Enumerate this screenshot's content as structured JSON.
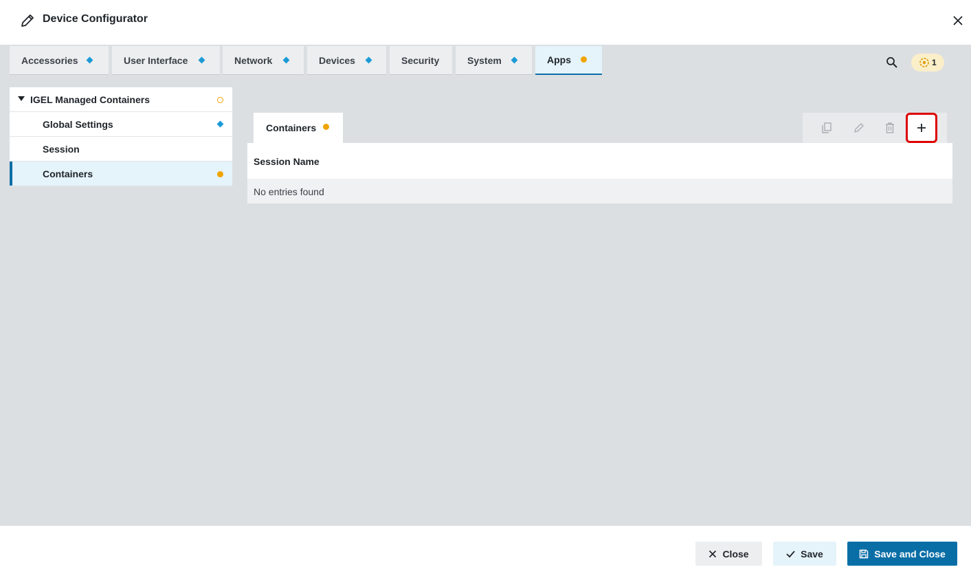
{
  "header": {
    "title": "Device Configurator",
    "edit_icon": "pencil-icon",
    "close_icon": "close-icon"
  },
  "tabs": [
    {
      "label": "Accessories",
      "marker": "diamond"
    },
    {
      "label": "User Interface",
      "marker": "diamond"
    },
    {
      "label": "Network",
      "marker": "diamond"
    },
    {
      "label": "Devices",
      "marker": "diamond"
    },
    {
      "label": "Security",
      "marker": "none"
    },
    {
      "label": "System",
      "marker": "diamond"
    },
    {
      "label": "Apps",
      "marker": "dot",
      "active": true
    }
  ],
  "top_right": {
    "search_icon": "search-icon",
    "notification_icon": "gear-eye-icon",
    "notification_count": "1"
  },
  "tree": {
    "root": {
      "label": "IGEL Managed Containers",
      "marker": "ring",
      "expanded": true
    },
    "items": [
      {
        "label": "Global Settings",
        "marker": "diamond"
      },
      {
        "label": "Session",
        "marker": "none"
      },
      {
        "label": "Containers",
        "marker": "dot",
        "selected": true
      }
    ]
  },
  "panel": {
    "tab_label": "Containers",
    "tab_marker": "dot",
    "toolbar": [
      "copy-icon",
      "edit-icon",
      "delete-icon",
      "add-icon"
    ],
    "table": {
      "columns": [
        "Session Name"
      ],
      "empty_text": "No entries found"
    }
  },
  "footer": {
    "close_label": "Close",
    "save_label": "Save",
    "save_close_label": "Save and Close"
  },
  "colors": {
    "accent": "#0a6ea6",
    "diamond": "#1b9ad6",
    "dot": "#f0a400",
    "highlight": "#dd0000",
    "background": "#dcdfe2"
  }
}
